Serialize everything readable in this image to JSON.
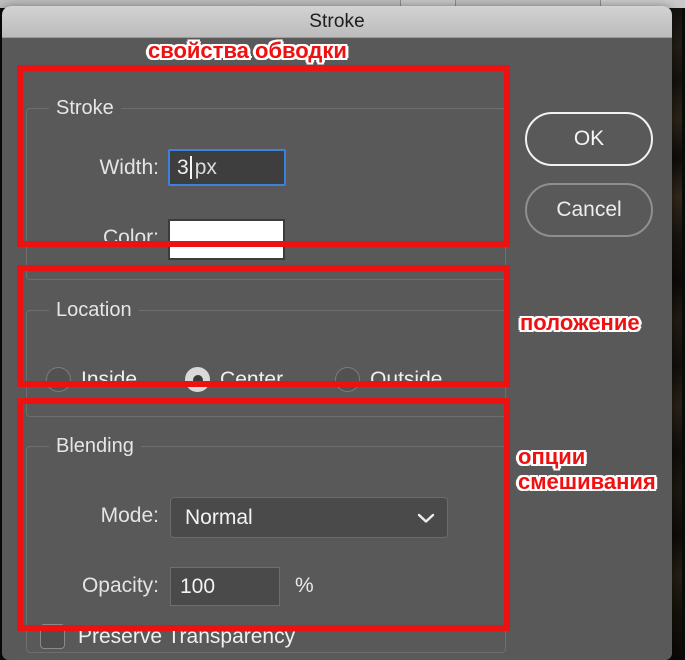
{
  "window": {
    "title": "Stroke"
  },
  "groups": {
    "stroke": {
      "legend": "Stroke",
      "width_label": "Width:",
      "width_value": "3",
      "width_unit": "px",
      "color_label": "Color:",
      "color_swatch_hex": "#ffffff"
    },
    "location": {
      "legend": "Location",
      "options": [
        {
          "label": "Inside",
          "selected": false
        },
        {
          "label": "Center",
          "selected": true
        },
        {
          "label": "Outside",
          "selected": false
        }
      ]
    },
    "blending": {
      "legend": "Blending",
      "mode_label": "Mode:",
      "mode_value": "Normal",
      "mode_chevron_icon": "chevron-down-icon",
      "opacity_label": "Opacity:",
      "opacity_value": "100",
      "opacity_unit": "%",
      "preserve_label": "Preserve Transparency",
      "preserve_checked": false
    }
  },
  "buttons": {
    "ok": "OK",
    "cancel": "Cancel"
  },
  "annotations": {
    "accent_hex": "#ee1111",
    "stroke_properties": "свойства обводки",
    "location": "положение",
    "blending_line1": "опции",
    "blending_line2": "смешивания"
  }
}
